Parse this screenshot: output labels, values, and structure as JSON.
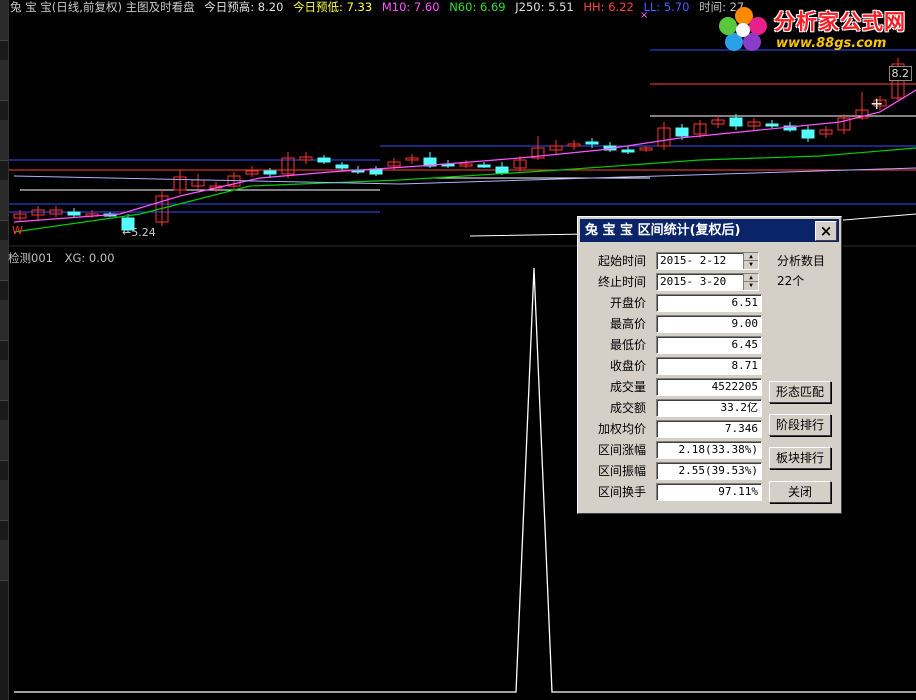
{
  "header": {
    "title": "兔 宝 宝(日线,前复权) 主图及时看盘",
    "today_high": "今日预高: 8.20",
    "today_low": "今日预低: 7.33",
    "m10": "M10: 7.60",
    "n60": "N60: 6.69",
    "j250": "J250: 5.51",
    "hh": "HH: 6.22",
    "ll": "LL: 5.70",
    "time": "时间: 27"
  },
  "chart": {
    "price_tag": "8.2",
    "low_label": "←5.24",
    "w_mark": "W",
    "close_x": "×",
    "colors": {
      "bull": "#ff3232",
      "bear": "#54ffff",
      "ma1": "#ff55ff",
      "ma2": "#00cc00",
      "ma3": "#ffffff",
      "hline_blue": "#3050ff",
      "hline_red": "#ff4040"
    }
  },
  "sub_chart": {
    "name": "检测001",
    "xg": "XG: 0.00"
  },
  "logo": {
    "text": "分析家公式网",
    "url": "www.88gs.com"
  },
  "dialog": {
    "title": "兔 宝 宝 区间统计(复权后)",
    "close_icon": "×",
    "fields": [
      {
        "label": "起始时间",
        "value": "2015- 2-12",
        "spin": true
      },
      {
        "label": "终止时间",
        "value": "2015- 3-20",
        "spin": true
      },
      {
        "label": "开盘价",
        "value": "6.51"
      },
      {
        "label": "最高价",
        "value": "9.00"
      },
      {
        "label": "最低价",
        "value": "6.45"
      },
      {
        "label": "收盘价",
        "value": "8.71"
      },
      {
        "label": "成交量",
        "value": "4522205"
      },
      {
        "label": "成交额",
        "value": "33.2亿"
      },
      {
        "label": "加权均价",
        "value": "7.346"
      },
      {
        "label": "区间涨幅",
        "value": "2.18(33.38%)"
      },
      {
        "label": "区间振幅",
        "value": "2.55(39.53%)"
      },
      {
        "label": "区间换手",
        "value": "97.11%"
      }
    ],
    "analysis_label": "分析数目",
    "analysis_count": "22个",
    "buttons": {
      "pattern": "形态匹配",
      "stage": "阶段排行",
      "sector": "板块排行",
      "close": "关闭"
    }
  }
}
